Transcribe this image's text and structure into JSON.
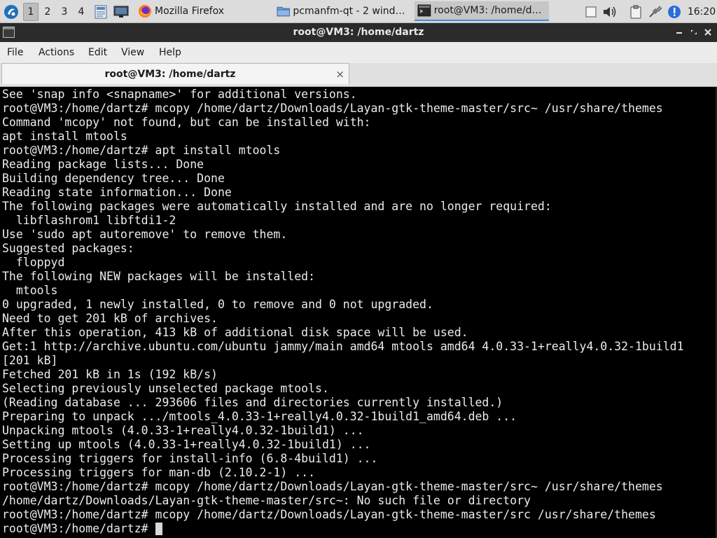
{
  "taskbar": {
    "desktops": [
      "1",
      "2",
      "3",
      "4"
    ],
    "active_desktop": "1",
    "tasks": [
      {
        "label": "Mozilla Firefox",
        "icon": "firefox-icon"
      },
      {
        "label": "pcmanfm-qt - 2 windo…",
        "icon": "folder-icon"
      },
      {
        "label": "root@VM3: /home/da…",
        "icon": "terminal-icon"
      }
    ],
    "clock": "16:20"
  },
  "window": {
    "title": "root@VM3: /home/dartz",
    "menu": [
      "File",
      "Actions",
      "Edit",
      "View",
      "Help"
    ],
    "tab_label": "root@VM3: /home/dartz",
    "tab_close": "×"
  },
  "terminal": {
    "lines": [
      "See 'snap info <snapname>' for additional versions.",
      "root@VM3:/home/dartz# mcopy /home/dartz/Downloads/Layan-gtk-theme-master/src~ /usr/share/themes",
      "Command 'mcopy' not found, but can be installed with:",
      "apt install mtools",
      "root@VM3:/home/dartz# apt install mtools",
      "Reading package lists... Done",
      "Building dependency tree... Done",
      "Reading state information... Done",
      "The following packages were automatically installed and are no longer required:",
      "  libflashrom1 libftdi1-2",
      "Use 'sudo apt autoremove' to remove them.",
      "Suggested packages:",
      "  floppyd",
      "The following NEW packages will be installed:",
      "  mtools",
      "0 upgraded, 1 newly installed, 0 to remove and 0 not upgraded.",
      "Need to get 201 kB of archives.",
      "After this operation, 413 kB of additional disk space will be used.",
      "Get:1 http://archive.ubuntu.com/ubuntu jammy/main amd64 mtools amd64 4.0.33-1+really4.0.32-1build1",
      "[201 kB]",
      "Fetched 201 kB in 1s (192 kB/s)",
      "Selecting previously unselected package mtools.",
      "(Reading database ... 293606 files and directories currently installed.)",
      "Preparing to unpack .../mtools_4.0.33-1+really4.0.32-1build1_amd64.deb ...",
      "Unpacking mtools (4.0.33-1+really4.0.32-1build1) ...",
      "Setting up mtools (4.0.33-1+really4.0.32-1build1) ...",
      "Processing triggers for install-info (6.8-4build1) ...",
      "Processing triggers for man-db (2.10.2-1) ...",
      "root@VM3:/home/dartz# mcopy /home/dartz/Downloads/Layan-gtk-theme-master/src~ /usr/share/themes",
      "/home/dartz/Downloads/Layan-gtk-theme-master/src~: No such file or directory",
      "root@VM3:/home/dartz# mcopy /home/dartz/Downloads/Layan-gtk-theme-master/src /usr/share/themes",
      "root@VM3:/home/dartz# "
    ]
  },
  "colors": {
    "terminal_bg": "#000000",
    "terminal_fg": "#ececec",
    "titlebar_bg": "#2b2b2b",
    "accent": "#3c8dd6"
  }
}
